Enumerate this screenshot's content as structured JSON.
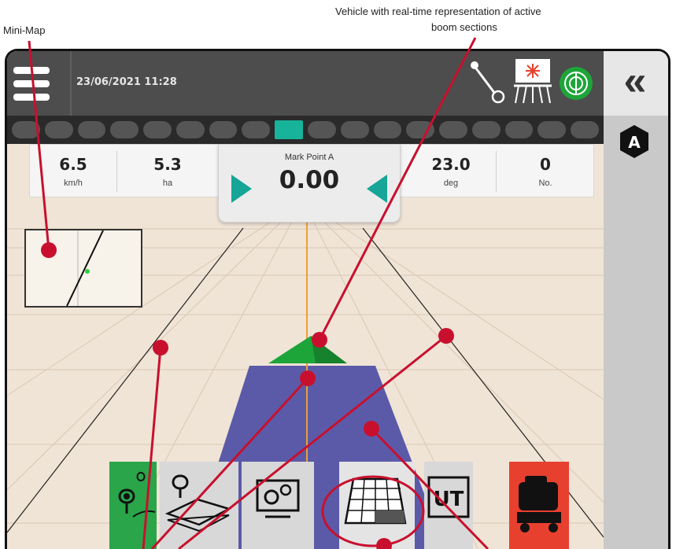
{
  "annotations": {
    "minimap_label": "Mini-Map",
    "vehicle_label_line1": "Vehicle with real-time representation of active",
    "vehicle_label_line2": "boom sections",
    "callout_color": "#c8102e"
  },
  "header": {
    "datetime": "23/06/2021 11:28",
    "icons": [
      "menu-icon",
      "steering-wheel-icon",
      "boom-sprayer-icon",
      "gps-status-icon"
    ]
  },
  "boom_sections": {
    "count": 18,
    "active_index": 8
  },
  "readouts": [
    {
      "value": "6.5",
      "unit": "km/h"
    },
    {
      "value": "5.3",
      "unit": "ha"
    },
    {
      "value": "23.0",
      "unit": "deg"
    },
    {
      "value": "0",
      "unit": "No."
    }
  ],
  "cross_track": {
    "title": "Mark Point A",
    "value": "0.00"
  },
  "right_panel": {
    "collapse_icon": "double-chevron-left-icon",
    "badge": "A"
  },
  "bottom_toolbar": {
    "items": [
      "guidance-point-icon",
      "map-layers-icon",
      "settings-monitor-icon",
      "coverage-map-icon",
      "virtual-terminal-icon",
      "sprayer-tank-icon"
    ],
    "virtual_terminal_label": "UT"
  },
  "colors": {
    "field_ground": "#f0e4d6",
    "coverage": "#5b5aa8",
    "guideline": "#e8a13a",
    "vehicle": "#1ea53a",
    "accent_teal": "#16a596",
    "top_bar": "#4d4d4d"
  }
}
